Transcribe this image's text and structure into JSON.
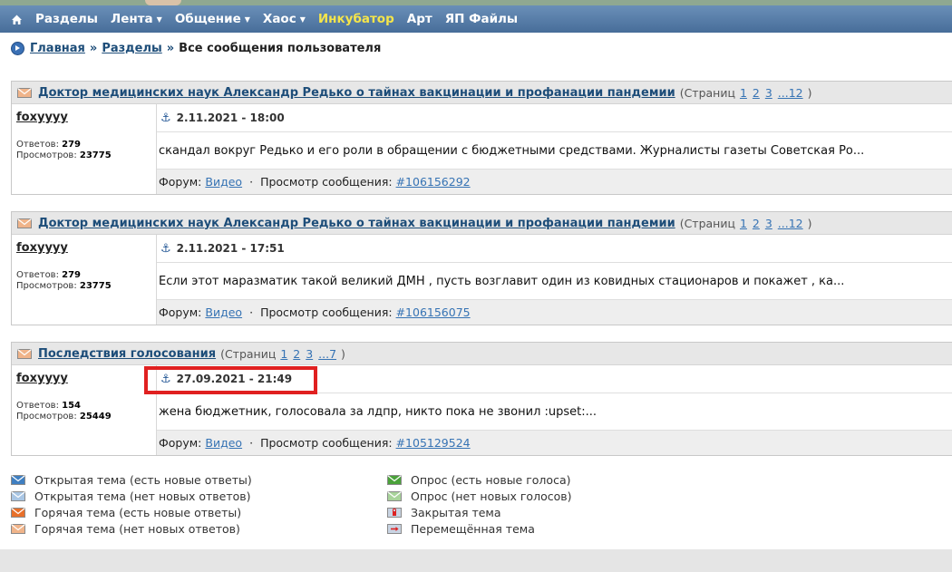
{
  "nav": {
    "home_icon": "home-icon",
    "items": [
      {
        "label": "Разделы",
        "caret": false,
        "highlight": false
      },
      {
        "label": "Лента",
        "caret": true,
        "highlight": false
      },
      {
        "label": "Общение",
        "caret": true,
        "highlight": false
      },
      {
        "label": "Хаос",
        "caret": true,
        "highlight": false
      },
      {
        "label": "Инкубатор",
        "caret": false,
        "highlight": true
      },
      {
        "label": "Арт",
        "caret": false,
        "highlight": false
      },
      {
        "label": "ЯП Файлы",
        "caret": false,
        "highlight": false
      }
    ]
  },
  "breadcrumb": {
    "home": "Главная",
    "section": "Разделы",
    "sep": "»",
    "current": "Все сообщения пользователя"
  },
  "labels": {
    "replies": "Ответов:",
    "views": "Просмотров:",
    "forum": "Форум:",
    "view_post": "Просмотр сообщения:",
    "pages_open": "(Страниц",
    "pages_close": ")"
  },
  "posts": [
    {
      "topic": "Доктор медицинских наук Александр Редько о тайнах вакцинации и профанации пандемии",
      "pages": [
        "1",
        "2",
        "3",
        "...12"
      ],
      "author": "foxyyyy",
      "replies": "279",
      "views": "23775",
      "date": "2.11.2021 - 18:00",
      "excerpt": "скандал вокруг Редько и его роли в обращении с бюджетными средствами. Журналисты газеты Советская Ро...",
      "forum": "Видео",
      "post_id": "#106156292"
    },
    {
      "topic": "Доктор медицинских наук Александр Редько о тайнах вакцинации и профанации пандемии",
      "pages": [
        "1",
        "2",
        "3",
        "...12"
      ],
      "author": "foxyyyy",
      "replies": "279",
      "views": "23775",
      "date": "2.11.2021 - 17:51",
      "excerpt": "Если этот маразматик такой великий ДМН , пусть возглавит один из ковидных стационаров и покажет , ка...",
      "forum": "Видео",
      "post_id": "#106156075"
    },
    {
      "topic": "Последствия голосования",
      "pages": [
        "1",
        "2",
        "3",
        "...7"
      ],
      "author": "foxyyyy",
      "replies": "154",
      "views": "25449",
      "date": "27.09.2021 - 21:49",
      "excerpt": "жена бюджетник, голосовала за лдпр, никто пока не звонил :upset:...",
      "forum": "Видео",
      "post_id": "#105129524"
    }
  ],
  "legend": {
    "left": [
      {
        "label": "Открытая тема (есть новые ответы)",
        "icon": "open-topic-new-icon",
        "color": "#3f7fc1"
      },
      {
        "label": "Открытая тема (нет новых ответов)",
        "icon": "open-topic-icon",
        "color": "#a9c6e4"
      },
      {
        "label": "Горячая тема (есть новые ответы)",
        "icon": "hot-topic-new-icon",
        "color": "#e8702a"
      },
      {
        "label": "Горячая тема (нет новых ответов)",
        "icon": "hot-topic-icon",
        "color": "#f0b48a"
      }
    ],
    "right": [
      {
        "label": "Опрос (есть новые голоса)",
        "icon": "poll-new-icon",
        "color": "#4aa23a"
      },
      {
        "label": "Опрос (нет новых голосов)",
        "icon": "poll-icon",
        "color": "#a8d39a"
      },
      {
        "label": "Закрытая тема",
        "icon": "closed-topic-icon",
        "color": "#c9d4e3"
      },
      {
        "label": "Перемещённая тема",
        "icon": "moved-topic-icon",
        "color": "#c9d4e3"
      }
    ]
  },
  "colors": {
    "nav_bg": "#476d99",
    "link": "#1d4d79",
    "highlight_border": "#e02020",
    "hot_envelope": "#f0b48a"
  }
}
